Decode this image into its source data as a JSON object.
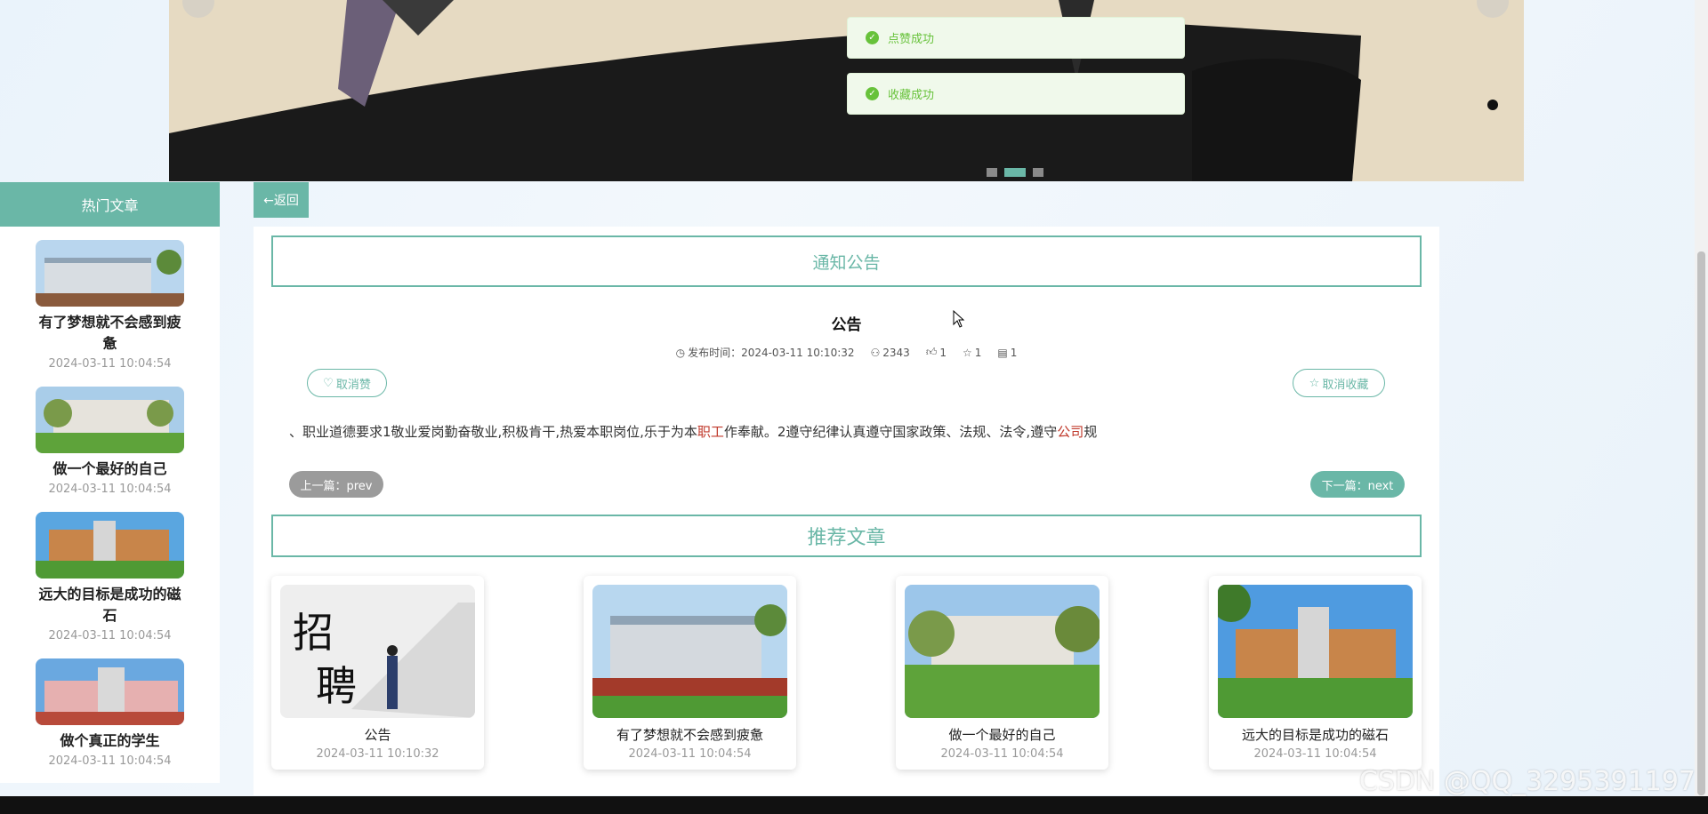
{
  "toasts": [
    {
      "text": "点赞成功"
    },
    {
      "text": "收藏成功"
    }
  ],
  "sidebar": {
    "header": "热门文章",
    "items": [
      {
        "title": "有了梦想就不会感到疲惫",
        "date": "2024-03-11 10:04:54"
      },
      {
        "title": "做一个最好的自己",
        "date": "2024-03-11 10:04:54"
      },
      {
        "title": "远大的目标是成功的磁石",
        "date": "2024-03-11 10:04:54"
      },
      {
        "title": "做个真正的学生",
        "date": "2024-03-11 10:04:54"
      }
    ]
  },
  "back_label": "←返回",
  "notice_header": "通知公告",
  "article": {
    "title": "公告",
    "publish_time": "发布时间：2024-03-11 10:10:32",
    "views": "2343",
    "likes": "1",
    "favorites": "1",
    "comments": "1",
    "unlike_label": "取消赞",
    "unfavorite_label": "取消收藏",
    "content_part1": "、职业道德要求1敬业爱岗勤奋敬业,积极肯干,热爱本职岗位,乐于为本",
    "content_hl1": "职工",
    "content_part2": "作奉献。2遵守纪律认真遵守国家政策、法规、法令,遵守",
    "content_hl2": "公司",
    "content_part3": "规",
    "prev_label": "上一篇：prev",
    "next_label": "下一篇：next"
  },
  "recommend_header": "推荐文章",
  "recommend": [
    {
      "title": "公告",
      "date": "2024-03-11 10:10:32"
    },
    {
      "title": "有了梦想就不会感到疲惫",
      "date": "2024-03-11 10:04:54"
    },
    {
      "title": "做一个最好的自己",
      "date": "2024-03-11 10:04:54"
    },
    {
      "title": "远大的目标是成功的磁石",
      "date": "2024-03-11 10:04:54"
    }
  ],
  "watermark": "CSDN @QQ_3295391197",
  "colors": {
    "accent": "#6ab7a7",
    "success": "#67c23a",
    "highlight": "#c0392b"
  }
}
